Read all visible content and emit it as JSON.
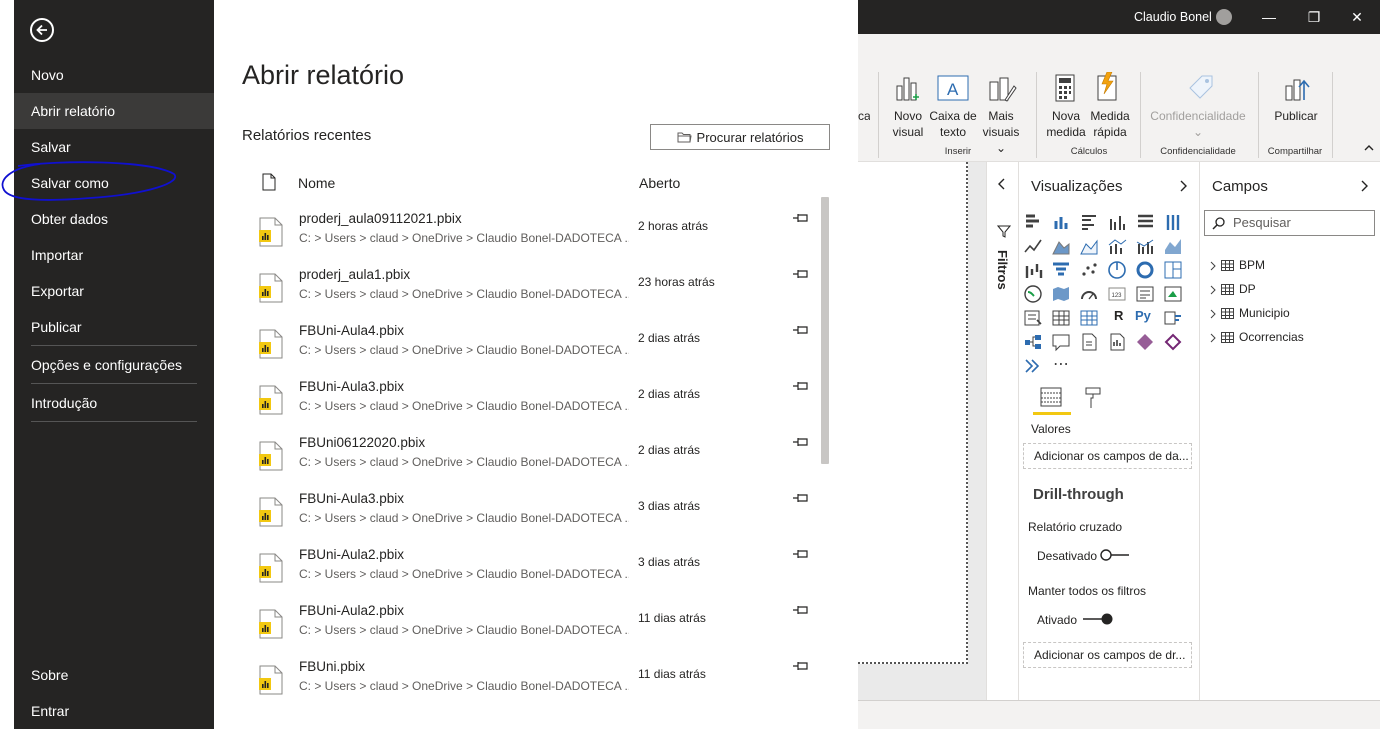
{
  "file_menu": {
    "items": [
      {
        "label": "Novo"
      },
      {
        "label": "Abrir relatório"
      },
      {
        "label": "Salvar"
      },
      {
        "label": "Salvar como"
      },
      {
        "label": "Obter dados"
      },
      {
        "label": "Importar"
      },
      {
        "label": "Exportar"
      },
      {
        "label": "Publicar"
      },
      {
        "label": "Opções e configurações"
      },
      {
        "label": "Introdução"
      }
    ],
    "bottom_items": [
      {
        "label": "Sobre"
      },
      {
        "label": "Entrar"
      }
    ],
    "active_item": "Abrir relatório"
  },
  "open_panel": {
    "title": "Abrir relatório",
    "recent_label": "Relatórios recentes",
    "browse_label": "Procurar relatórios",
    "col_name": "Nome",
    "col_opened": "Aberto",
    "files": [
      {
        "name": "proderj_aula09112021.pbix",
        "path": "C: > Users > claud > OneDrive > Claudio Bonel-DADOTECA ...",
        "opened": "2 horas atrás"
      },
      {
        "name": "proderj_aula1.pbix",
        "path": "C: > Users > claud > OneDrive > Claudio Bonel-DADOTECA ...",
        "opened": "23 horas atrás"
      },
      {
        "name": "FBUni-Aula4.pbix",
        "path": "C: > Users > claud > OneDrive > Claudio Bonel-DADOTECA ...",
        "opened": "2 dias atrás"
      },
      {
        "name": "FBUni-Aula3.pbix",
        "path": "C: > Users > claud > OneDrive > Claudio Bonel-DADOTECA ...",
        "opened": "2 dias atrás"
      },
      {
        "name": "FBUni06122020.pbix",
        "path": "C: > Users > claud > OneDrive > Claudio Bonel-DADOTECA ...",
        "opened": "2 dias atrás"
      },
      {
        "name": "FBUni-Aula3.pbix",
        "path": "C: > Users > claud > OneDrive > Claudio Bonel-DADOTECA ...",
        "opened": "3 dias atrás"
      },
      {
        "name": "FBUni-Aula2.pbix",
        "path": "C: > Users > claud > OneDrive > Claudio Bonel-DADOTECA ...",
        "opened": "3 dias atrás"
      },
      {
        "name": "FBUni-Aula2.pbix",
        "path": "C: > Users > claud > OneDrive > Claudio Bonel-DADOTECA ...",
        "opened": "11 dias atrás"
      },
      {
        "name": "FBUni.pbix",
        "path": "C: > Users > claud > OneDrive > Claudio Bonel-DADOTECA ...",
        "opened": "11 dias atrás"
      }
    ]
  },
  "window": {
    "user_name": "Claudio Bonel",
    "min_glyph": "—",
    "max_glyph": "❐",
    "close_glyph": "✕"
  },
  "ribbon": {
    "partial_label": "car",
    "novo_visual": [
      "Novo",
      "visual"
    ],
    "caixa_texto": [
      "Caixa de",
      "texto"
    ],
    "mais_visuais": [
      "Mais",
      "visuais ⌄"
    ],
    "nova_medida": [
      "Nova",
      "medida"
    ],
    "medida_rapida": [
      "Medida",
      "rápida"
    ],
    "confidencialidade": "Confidencialidade",
    "publicar": "Publicar",
    "groups": {
      "inserir": "Inserir",
      "calculos": "Cálculos",
      "confidencialidade": "Confidencialidade",
      "compartilhar": "Compartilhar"
    }
  },
  "filters": {
    "label": "Filtros"
  },
  "visualizations": {
    "title": "Visualizações",
    "r_label": "R",
    "py_label": "Py",
    "more_label": "⋯",
    "values_label": "Valores",
    "add_fields_1": "Adicionar os campos de da...",
    "drill_title": "Drill-through",
    "cross_report": "Relatório cruzado",
    "cross_state": "Desativado",
    "keep_filters": "Manter todos os filtros",
    "keep_state": "Ativado",
    "add_fields_2": "Adicionar os campos de dr..."
  },
  "fields": {
    "title": "Campos",
    "search_placeholder": "Pesquisar",
    "tables": [
      {
        "name": "BPM"
      },
      {
        "name": "DP"
      },
      {
        "name": "Municipio"
      },
      {
        "name": "Ocorrencias"
      }
    ]
  },
  "colors": {
    "menu_bg": "#252423",
    "menu_active": "#3b3a39",
    "accent_yellow": "#f2c811",
    "scribble_blue": "#1010d0"
  }
}
